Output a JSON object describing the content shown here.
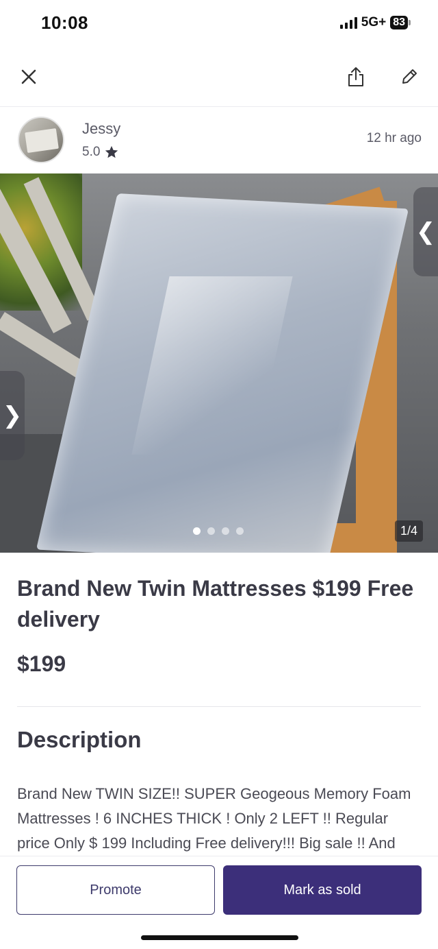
{
  "status_bar": {
    "time": "10:08",
    "network": "5G+",
    "battery": "83"
  },
  "top_bar": {
    "close_icon": "close-icon",
    "share_icon": "share-icon",
    "edit_icon": "pencil-icon"
  },
  "seller": {
    "name": "Jessy",
    "rating": "5.0",
    "rating_icon": "star-icon",
    "posted": "12 hr  ago"
  },
  "photo": {
    "counter": "1/4",
    "total_images": 4,
    "current_index": 1
  },
  "listing": {
    "title": "Brand New Twin Mattresses $199 Free delivery",
    "price": "$199"
  },
  "description": {
    "heading": "Description",
    "body": "Brand New TWIN SIZE!! SUPER Geogeous Memory Foam Mattresses ! 6 INCHES THICK ! Only 2 LEFT !! Regular price Only $ 199 Including Free delivery!!! Big sale !! And"
  },
  "actions": {
    "promote": "Promote",
    "mark_sold": "Mark as sold"
  },
  "colors": {
    "primary": "#3c2f7a",
    "text": "#3a3a46",
    "divider": "#e6e6ea"
  }
}
